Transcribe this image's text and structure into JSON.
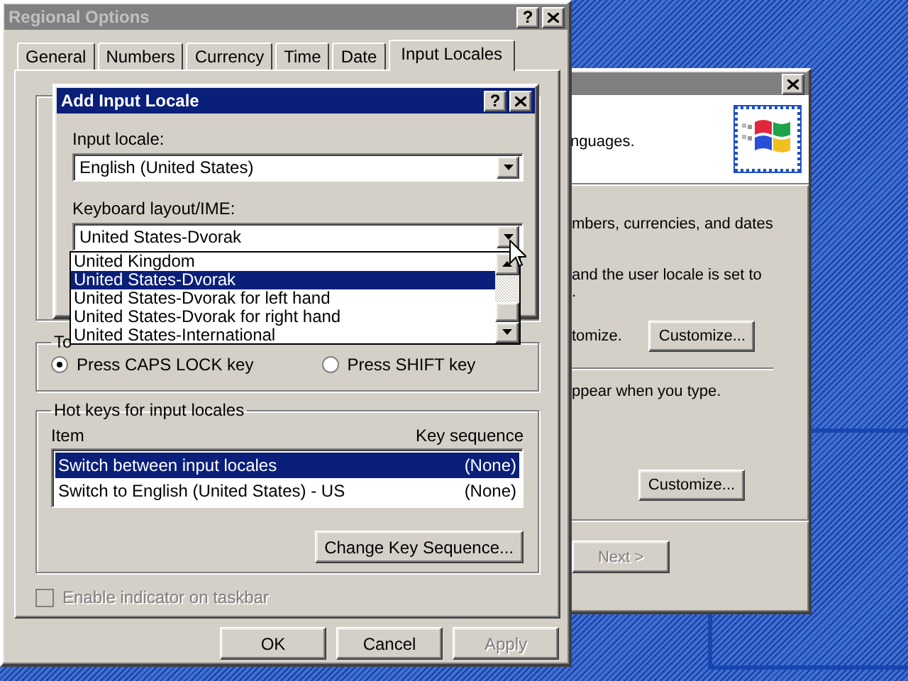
{
  "background_window": {
    "active": false,
    "header_text": "nguages.",
    "lines": [
      "mbers, currencies, and dates",
      "and the user locale is set to",
      "."
    ],
    "customize_label": "tomize.",
    "buttons": [
      {
        "label": "Customize...",
        "disabled": false
      },
      {
        "label": "Customize...",
        "disabled": false
      }
    ],
    "section_text": "ppear when you type.",
    "next_button": {
      "label": "Next >",
      "disabled": true
    }
  },
  "regional_options": {
    "title": "Regional Options",
    "active": false,
    "help": "?",
    "tabs": [
      {
        "label": "General",
        "selected": false
      },
      {
        "label": "Numbers",
        "selected": false
      },
      {
        "label": "Currency",
        "selected": false
      },
      {
        "label": "Time",
        "selected": false
      },
      {
        "label": "Date",
        "selected": false
      },
      {
        "label": "Input Locales",
        "selected": true
      }
    ],
    "caps_lock": {
      "title": "To",
      "options": [
        {
          "label": "Press CAPS LOCK key",
          "selected": true
        },
        {
          "label": "Press SHIFT key",
          "selected": false
        }
      ]
    },
    "hot_keys": {
      "title": "Hot keys for input locales",
      "columns": [
        "Item",
        "Key sequence"
      ],
      "rows": [
        {
          "item": "Switch between input locales",
          "key_sequence": "(None)",
          "selected": true
        },
        {
          "item": "Switch to English (United States) - US",
          "key_sequence": "(None)",
          "selected": false
        }
      ],
      "button": "Change Key Sequence..."
    },
    "taskbar_indicator": {
      "label": "Enable indicator on taskbar",
      "checked": false,
      "disabled": true
    },
    "buttons": [
      {
        "label": "OK",
        "disabled": false
      },
      {
        "label": "Cancel",
        "disabled": false
      },
      {
        "label": "Apply",
        "disabled": true
      }
    ]
  },
  "add_input_locale": {
    "title": "Add Input Locale",
    "active": true,
    "help": "?",
    "input_locale": {
      "label": "Input locale:",
      "value": "English (United States)"
    },
    "keyboard_layout": {
      "label": "Keyboard layout/IME:",
      "value": "United States-Dvorak",
      "open": true,
      "options": [
        {
          "label": "United Kingdom",
          "selected": false
        },
        {
          "label": "United States-Dvorak",
          "selected": true
        },
        {
          "label": "United States-Dvorak for left hand",
          "selected": false
        },
        {
          "label": "United States-Dvorak for right hand",
          "selected": false
        },
        {
          "label": "United States-International",
          "selected": false
        }
      ]
    }
  }
}
